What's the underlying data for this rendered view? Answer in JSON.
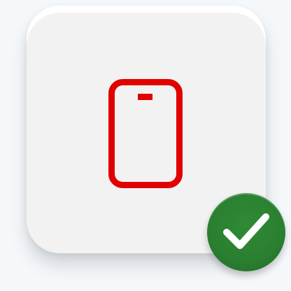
{
  "icon": {
    "name": "mobile-phone-icon",
    "color": "#e00000"
  },
  "badge": {
    "name": "checkmark-icon",
    "status": "verified",
    "background_color": "#2a7f30",
    "mark_color": "#ffffff"
  },
  "tile": {
    "background_color": "#f3f2f2"
  },
  "page": {
    "background_color": "#f5f8fb"
  }
}
